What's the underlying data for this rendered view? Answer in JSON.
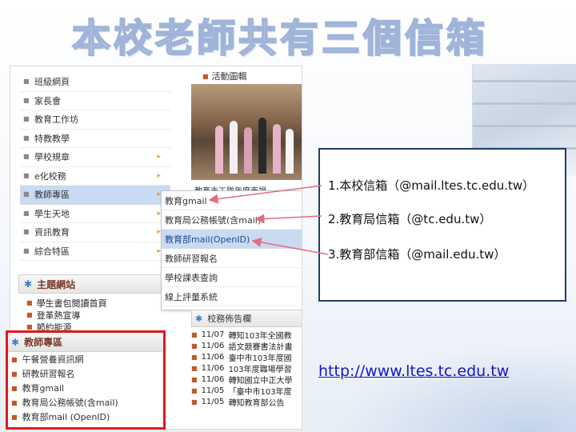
{
  "slide": {
    "title": "本校老師共有三個信箱",
    "url": "http://www.ltes.tc.edu.tw"
  },
  "callout": {
    "lines": [
      "1.本校信箱（@mail.ltes.tc.edu.tw）",
      "2.教育局信箱（@tc.edu.tw）",
      "3.教育部信箱（@mail.edu.tw）"
    ]
  },
  "website": {
    "nav": [
      {
        "label": "班級網頁"
      },
      {
        "label": "家長會"
      },
      {
        "label": "教育工作坊"
      },
      {
        "label": "特教教學"
      },
      {
        "label": "學校規章",
        "arrow": true
      },
      {
        "label": "e化校務",
        "arrow": true
      },
      {
        "label": "教師專區",
        "arrow": true,
        "active": true
      },
      {
        "label": "學生天地",
        "arrow": true
      },
      {
        "label": "資訊教育",
        "arrow": true
      },
      {
        "label": "綜合特區",
        "arrow": true
      }
    ],
    "theme_header": "主題網站",
    "theme_items": [
      "學生書包閱讀首頁",
      "登革熱宣導",
      "節約能源"
    ],
    "teacher_header": "教師專區",
    "teacher_items": [
      "午餐營養資訊網",
      "研教研習報名",
      "教育gmail",
      "教育局公務帳號(含mail)",
      "教育部mail (OpenID)"
    ],
    "popup_items": [
      {
        "label": "教育gmail"
      },
      {
        "label": "教育局公務帳號(含mail)"
      },
      {
        "label": "教育部mail(OpenID)",
        "active": true
      },
      {
        "label": "教師研習報名"
      },
      {
        "label": "學校課表查詢"
      },
      {
        "label": "線上評量系統"
      }
    ],
    "photo_header": "活動圖輯",
    "photo_caption": "教育志工隊年度表揚~",
    "news_header": "校務佈告欄",
    "news": [
      {
        "date": "11/07",
        "text": "轉知103年全國教"
      },
      {
        "date": "11/06",
        "text": "語文競賽書法計畫"
      },
      {
        "date": "11/06",
        "text": "臺中市103年度國"
      },
      {
        "date": "11/06",
        "text": "103年度職場學習"
      },
      {
        "date": "11/06",
        "text": "轉知國立中正大學"
      },
      {
        "date": "11/05",
        "text": "「臺中市103年度"
      },
      {
        "date": "11/05",
        "text": "轉知教育部公告"
      }
    ]
  },
  "colors": {
    "callout_border": "#1c3d72",
    "highlight_box": "#e0191b",
    "arrow": "#e07080",
    "url": "#1515c8"
  }
}
